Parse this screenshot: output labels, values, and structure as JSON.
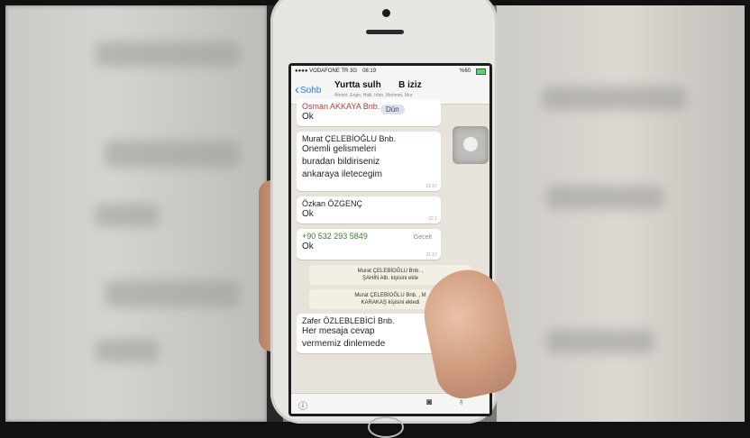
{
  "status_bar": {
    "carrier": "●●●● VODAFONE TR  3G",
    "time": "08:19",
    "battery": "%60"
  },
  "nav": {
    "back_label": "Sohb",
    "title_part1": "Yurtta sulh",
    "title_part2": "B iziz",
    "subtitle": "Ahmet, Ergin, Halil, Irfan, Mehmet, Mur"
  },
  "messages": [
    {
      "sender": "Osman AKKAYA Bnb.",
      "text": "Ok",
      "day_pill": "Dün"
    },
    {
      "sender": "Murat ÇELEBİOĞLU Bnb.",
      "lines": [
        "Onemli gelismeleri",
        "buradan bildiriseniz",
        "ankaraya iletecegim"
      ],
      "time": "21.57"
    },
    {
      "sender": "Özkan ÖZGENÇ",
      "text": "Ok",
      "time": "22.1"
    },
    {
      "sender": "+90 532 293 5849",
      "sender_meta": "Gecelt",
      "text": "Ok",
      "time": "21.57"
    }
  ],
  "system_notes": [
    {
      "line1": "Murat ÇELEBİOĞLU Bnb. ,",
      "line2": "ŞAHİN Alb. kişisini ekle"
    },
    {
      "line1": "Murat ÇELEBİOĞLU Bnb. , M",
      "line2": "KARAKAŞ kişisini ekledi"
    }
  ],
  "last_message": {
    "sender": "Zafer ÖZLEBLEBİCİ Bnb.",
    "lines": [
      "Her mesaja cevap",
      "vermemiz dinlemede"
    ]
  }
}
